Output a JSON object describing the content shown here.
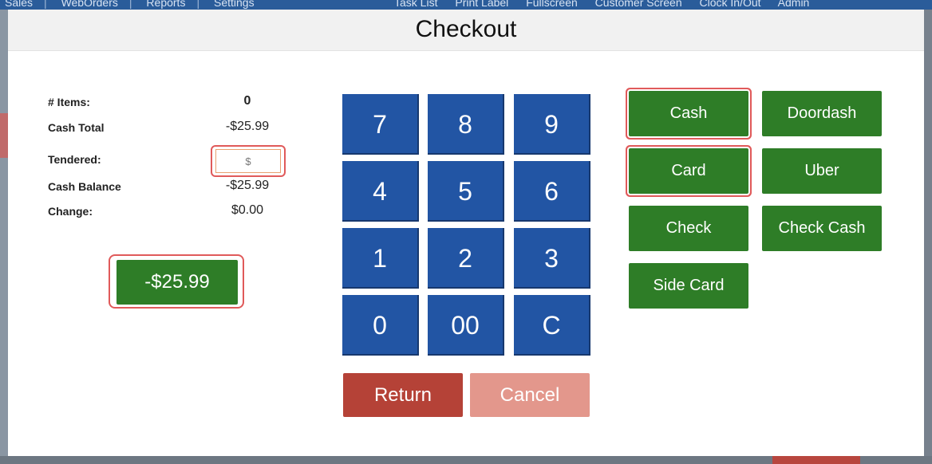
{
  "background": {
    "nav_items": [
      "Sales",
      "WebOrders",
      "Reports",
      "Settings"
    ],
    "right_items": [
      "Task List",
      "Print Label",
      "Fullscreen",
      "Customer Screen",
      "Clock In/Out",
      "Admin"
    ]
  },
  "modal": {
    "title": "Checkout"
  },
  "summary": {
    "items_label": "# Items:",
    "items_value": "0",
    "cash_total_label": "Cash Total",
    "cash_total_value": "-$25.99",
    "tendered_label": "Tendered:",
    "tendered_placeholder": "$",
    "tendered_value": "",
    "cash_balance_label": "Cash Balance",
    "cash_balance_value": "-$25.99",
    "change_label": "Change:",
    "change_value": "$0.00"
  },
  "amount_button": "-$25.99",
  "keypad": {
    "keys": [
      "7",
      "8",
      "9",
      "4",
      "5",
      "6",
      "1",
      "2",
      "3",
      "0",
      "00",
      "C"
    ]
  },
  "actions": {
    "return_label": "Return",
    "cancel_label": "Cancel"
  },
  "payment_methods": {
    "cash": "Cash",
    "doordash": "Doordash",
    "card": "Card",
    "uber": "Uber",
    "check": "Check",
    "check_cash": "Check Cash",
    "side_card": "Side Card"
  },
  "colors": {
    "accent_green": "#2e7d27",
    "keypad_blue": "#2255a4",
    "return_red": "#b54237",
    "cancel_pink": "#e3978c",
    "highlight_red": "#e05a5a"
  }
}
